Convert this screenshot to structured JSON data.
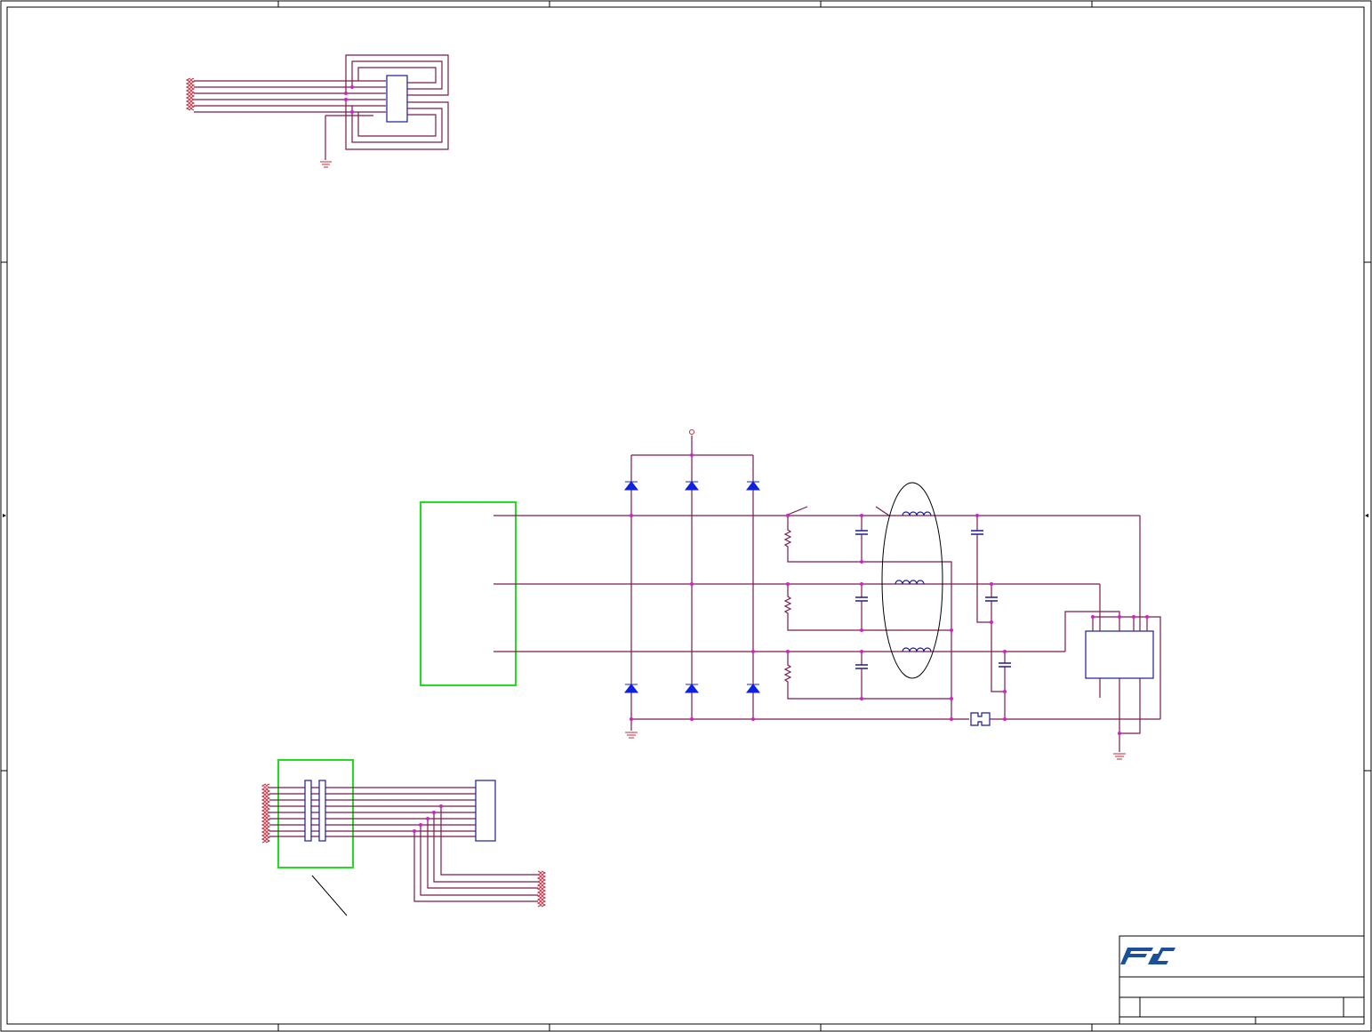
{
  "colors": {
    "wire": "#7a1c4c",
    "net_label": "#c0283c",
    "component": "#1a1a9c",
    "diode": "#1020e0",
    "junction": "#d020d0",
    "highlight": "#22dd22",
    "logo": "#1a4f9c"
  },
  "icons": {
    "logo": "fic-logo-icon",
    "ground": "ground-icon",
    "diode": "diode-icon",
    "resistor": "resistor-icon",
    "capacitor": "capacitor-icon",
    "inductor": "inductor-icon",
    "fuse": "fuse-icon",
    "connector": "connector-icon"
  },
  "title_block": {
    "logo_text": "FIC"
  }
}
